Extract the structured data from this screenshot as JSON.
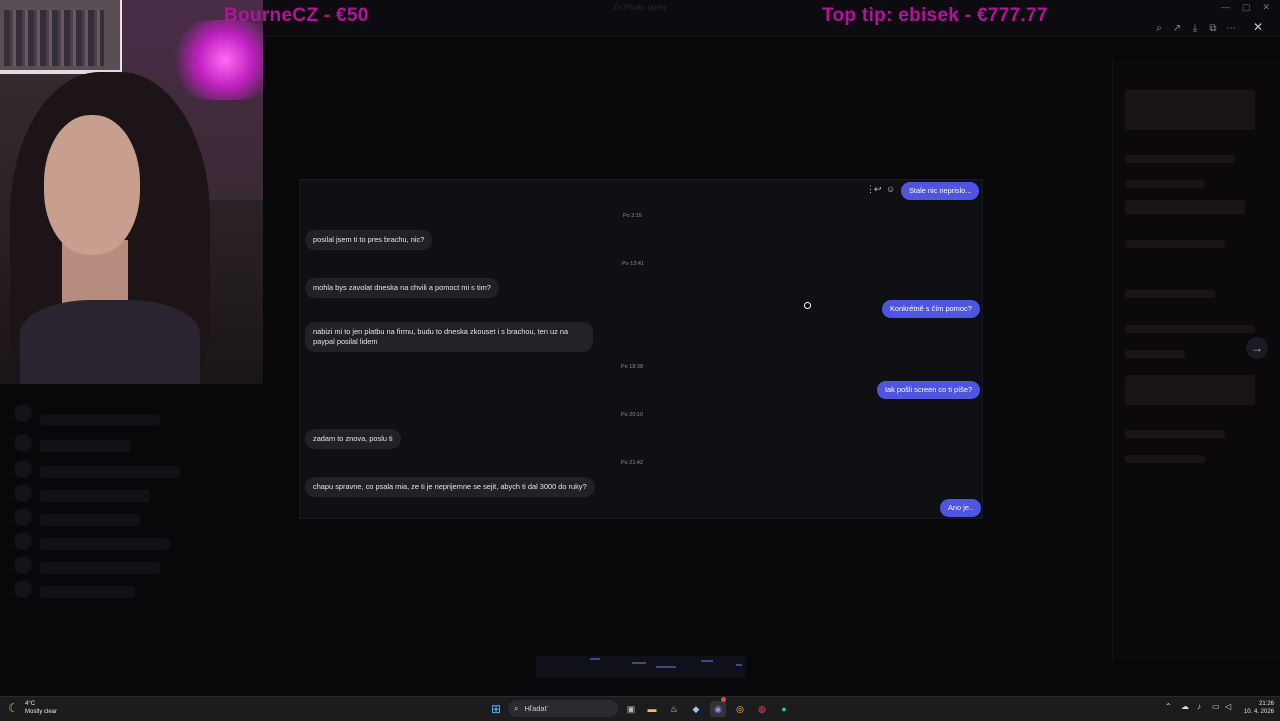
{
  "overlay": {
    "alert_left": "BourneCZ - €50",
    "alert_right": "Top tip: ebisek - €777.77"
  },
  "chat": {
    "header_out": "Stale nic neprislo...",
    "messages": [
      {
        "type": "timestamp",
        "text": "Po 2:15"
      },
      {
        "type": "in",
        "text": "posilal jsem ti to pres brachu, nic?"
      },
      {
        "type": "timestamp",
        "text": "Po 13:41"
      },
      {
        "type": "in",
        "text": "mohla bys zavolat dneska na chvili a pomoct mi s tim?"
      },
      {
        "type": "out",
        "text": "Konkrétně s čím pomoc?"
      },
      {
        "type": "in",
        "text": "nabizi mi to jen platbu na firmu, budu to dneska zkouset i s brachou, ten uz na paypal posilal lidem"
      },
      {
        "type": "timestamp",
        "text": "Po 18:38"
      },
      {
        "type": "out",
        "text": "tak pošli screen co ti píše?"
      },
      {
        "type": "timestamp",
        "text": "Po 20:10"
      },
      {
        "type": "in",
        "text": "zadam to znova, poslu ti"
      },
      {
        "type": "timestamp",
        "text": "Po 21:42"
      },
      {
        "type": "in",
        "text": "chapu spravne, co psala mia, ze ti je neprijemne se sejit, abych ti dal 3000 do ruky?"
      },
      {
        "type": "out",
        "text": "Ano je.."
      }
    ]
  },
  "viewer_toolbar": {
    "icons": [
      "zoom-in-icon",
      "share-icon",
      "download-icon",
      "open-external-icon",
      "more-icon"
    ],
    "close": "✕",
    "next": "→"
  },
  "window_title": "Zo Photo query",
  "taskbar": {
    "weather_temp": "4°C",
    "weather_desc": "Mostly clear",
    "search_placeholder": "Hľadať",
    "time": "21:26",
    "date": "10. 4. 2026"
  },
  "colors": {
    "alert": "#b8109e",
    "outgoing_bubble": "#4e55e0",
    "incoming_bubble": "#202226",
    "chat_bg": "#0f1014"
  }
}
